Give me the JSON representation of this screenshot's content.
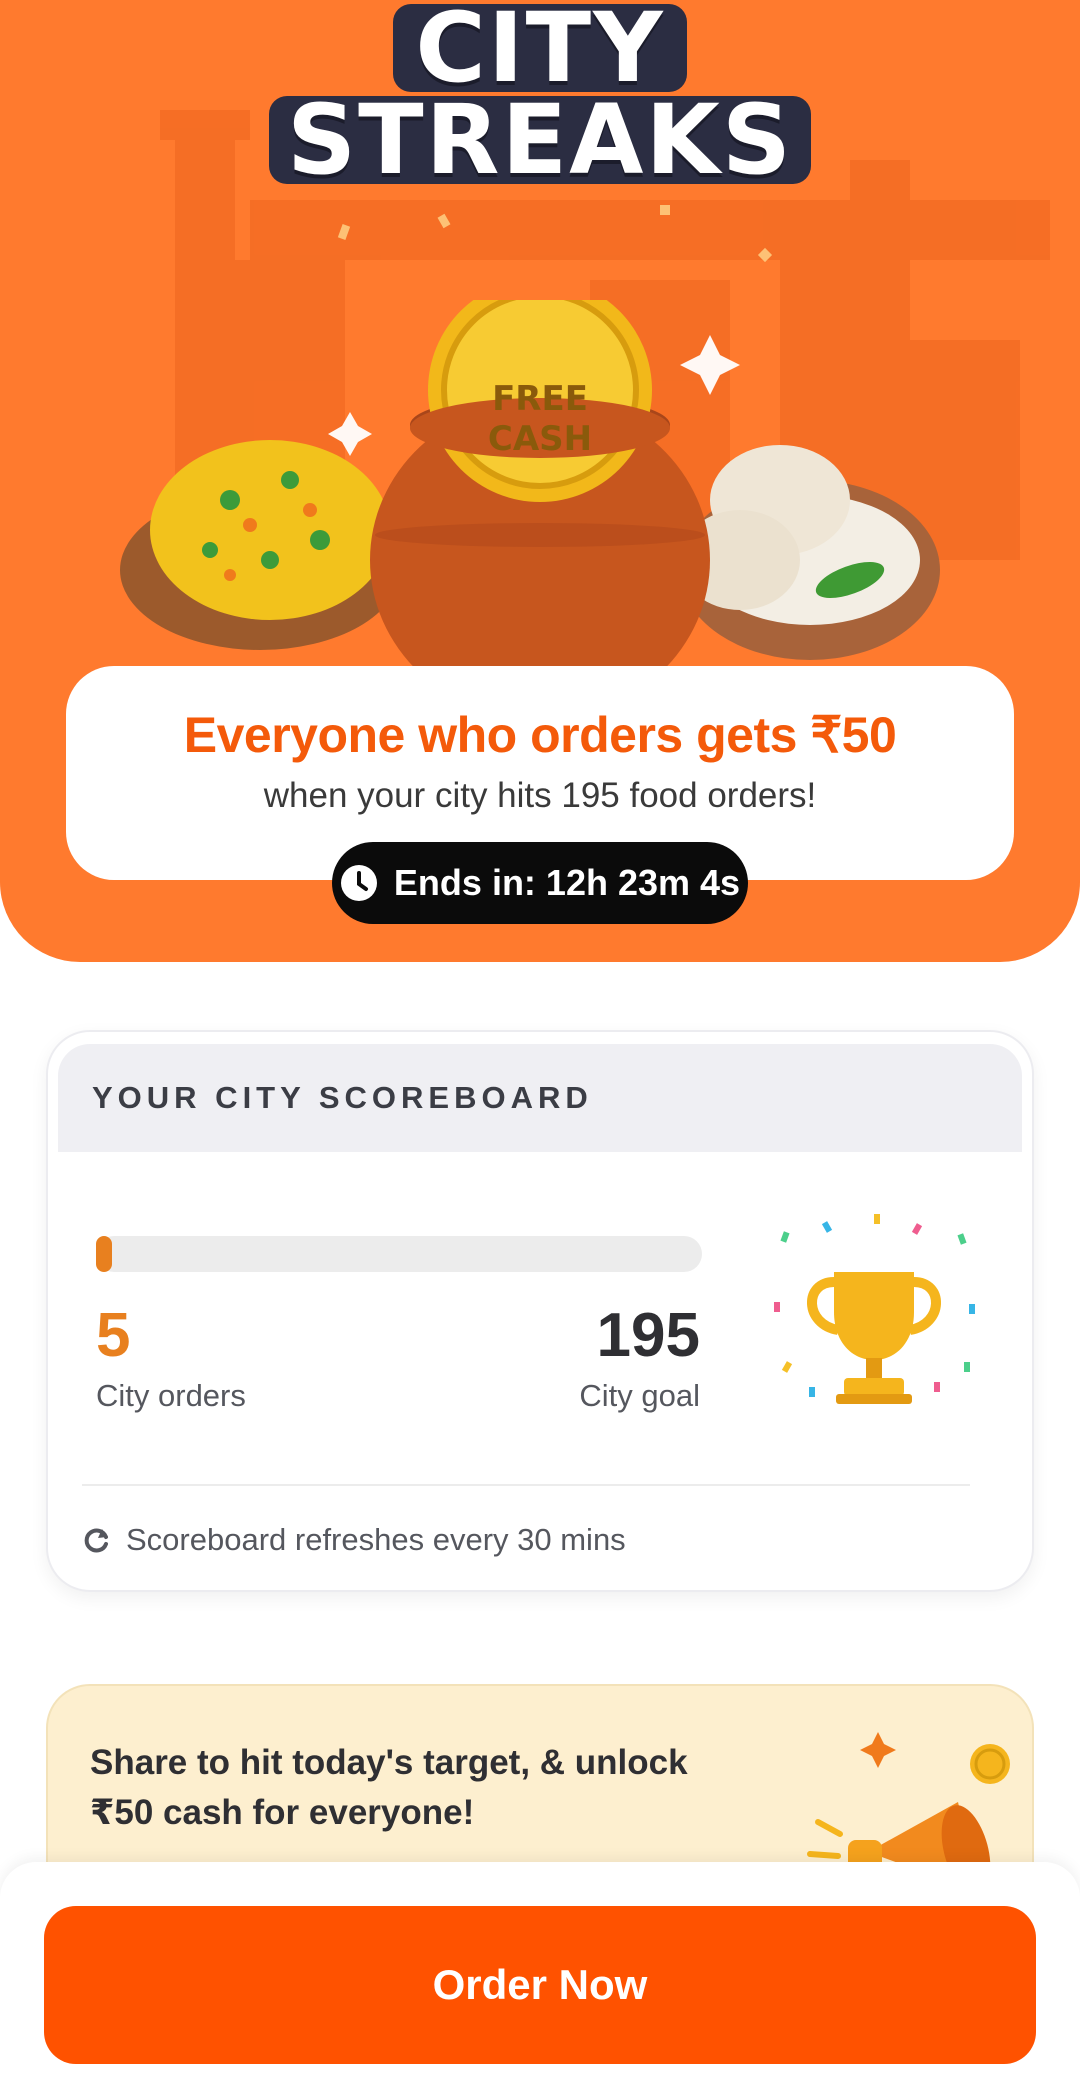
{
  "hero": {
    "logo_line1": "CITY",
    "logo_line2": "STREAKS",
    "coin_text_line1": "FREE",
    "coin_text_line2": "CASH",
    "headline": "Everyone who orders gets ₹50",
    "subline": "when your city hits 195 food orders!",
    "timer_text": "Ends in: 12h 23m 4s"
  },
  "scoreboard": {
    "title": "YOUR CITY SCOREBOARD",
    "city_orders_value": "5",
    "city_orders_label": "City orders",
    "city_goal_value": "195",
    "city_goal_label": "City goal",
    "progress_fraction": 0.026,
    "refresh_note": "Scoreboard refreshes every 30 mins"
  },
  "share": {
    "line1": "Share to hit today's target, & unlock",
    "line2": "₹50 cash for everyone!"
  },
  "cta": {
    "order_label": "Order Now"
  },
  "colors": {
    "hero_bg": "#FF7A2E",
    "accent_orange": "#F45A0A",
    "progress_orange": "#E8801F",
    "cta_orange": "#FF5200",
    "share_bg": "#FDEFCF"
  },
  "icons": {
    "timer": "clock-icon",
    "refresh": "refresh-icon",
    "trophy": "trophy-icon",
    "share": "megaphone-icon"
  }
}
